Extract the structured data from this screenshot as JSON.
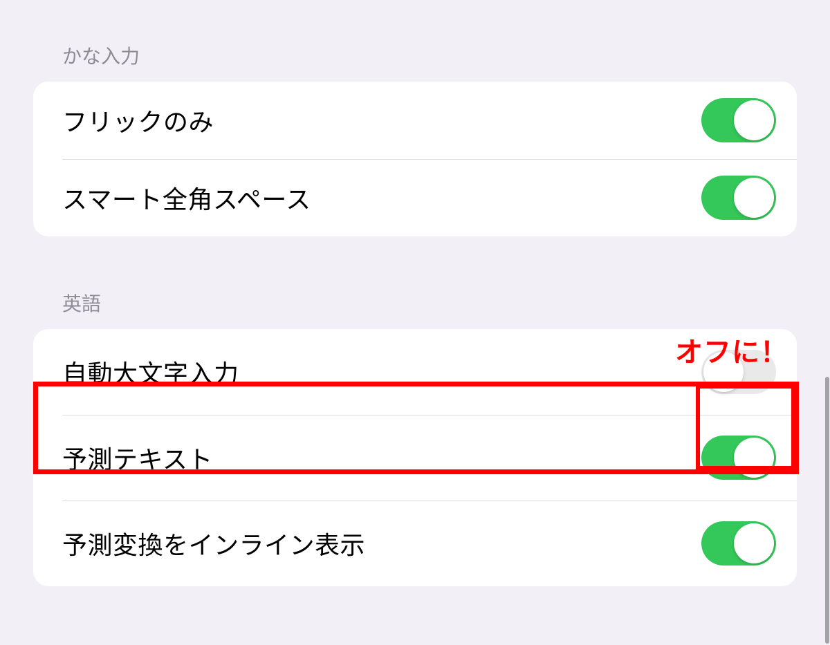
{
  "sections": {
    "kana": {
      "header": "かな入力",
      "items": [
        {
          "label": "フリックのみ",
          "on": true
        },
        {
          "label": "スマート全角スペース",
          "on": true
        }
      ]
    },
    "english": {
      "header": "英語",
      "items": [
        {
          "label": "自動大文字入力",
          "on": false
        },
        {
          "label": "予測テキスト",
          "on": true
        },
        {
          "label": "予測変換をインライン表示",
          "on": true
        }
      ]
    }
  },
  "annotation": {
    "callout": "オフに！"
  }
}
